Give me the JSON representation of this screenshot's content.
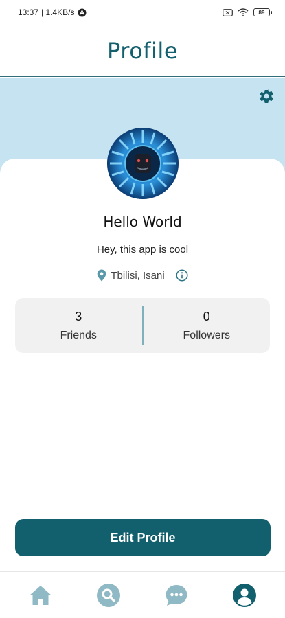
{
  "status_bar": {
    "time": "13:37",
    "network_speed": "| 1.4KB/s",
    "battery": "89"
  },
  "header": {
    "title": "Profile"
  },
  "colors": {
    "primary": "#12606d",
    "banner": "#c6e3f2",
    "nav_inactive": "#8fb9c4"
  },
  "profile": {
    "name": "Hello World",
    "bio": "Hey, this app is cool",
    "location": "Tbilisi, Isani"
  },
  "stats": [
    {
      "count": "3",
      "label": "Friends"
    },
    {
      "count": "0",
      "label": "Followers"
    }
  ],
  "actions": {
    "edit_profile": "Edit Profile"
  },
  "bottom_nav": {
    "items": [
      {
        "icon": "home-icon",
        "active": false
      },
      {
        "icon": "search-icon",
        "active": false
      },
      {
        "icon": "chat-icon",
        "active": false
      },
      {
        "icon": "profile-icon",
        "active": true
      }
    ]
  }
}
